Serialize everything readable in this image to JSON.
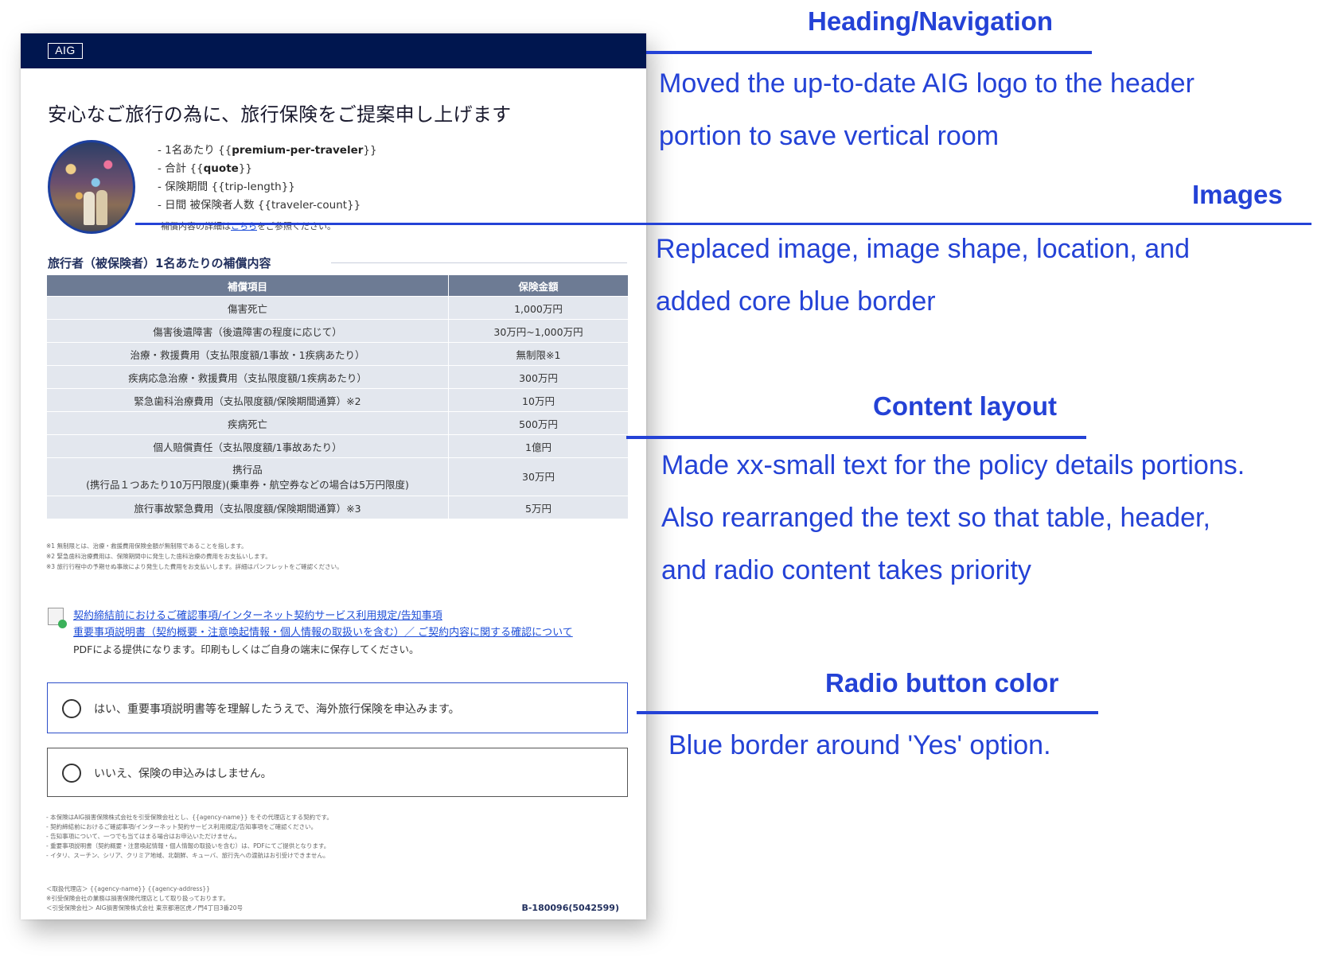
{
  "document": {
    "logo": "AIG",
    "title": "安心なご旅行の為に、旅行保険をご提案申し上げます",
    "premium_lines": [
      {
        "prefix": "- 1名あたり {{",
        "value": "premium-per-traveler",
        "suffix": "}}"
      },
      {
        "prefix": "- 合計 {{",
        "value": "quote",
        "suffix": "}}"
      },
      {
        "prefix": "- 保険期間 {{",
        "value": "trip-length",
        "suffix": "}}"
      },
      {
        "prefix": "- 日間 被保険者人数 {{",
        "value": "traveler-count",
        "suffix": "}}"
      }
    ],
    "detail_prefix": "補償内容の詳細は",
    "detail_link": "こちら",
    "detail_suffix": "をご参照ください。",
    "section_title": "旅行者（被保険者）1名あたりの補償内容",
    "table": {
      "headers": [
        "補償項目",
        "保険金額"
      ],
      "rows": [
        [
          "傷害死亡",
          "1,000万円"
        ],
        [
          "傷害後遺障害（後遺障害の程度に応じて）",
          "30万円~1,000万円"
        ],
        [
          "治療・救援費用（支払限度額/1事故・1疾病あたり）",
          "無制限※1"
        ],
        [
          "疾病応急治療・救援費用（支払限度額/1疾病あたり）",
          "300万円"
        ],
        [
          "緊急歯科治療費用（支払限度額/保険期間通算）※2",
          "10万円"
        ],
        [
          "疾病死亡",
          "500万円"
        ],
        [
          "個人賠償責任（支払限度額/1事故あたり）",
          "1億円"
        ],
        [
          "携行品\n(携行品１つあたり10万円限度)(乗車券・航空券などの場合は5万円限度)",
          "30万円"
        ],
        [
          "旅行事故緊急費用（支払限度額/保険期間通算）※3",
          "5万円"
        ]
      ]
    },
    "notes": [
      "※1 無制限とは、治療・救援費用保険金額が無制限であることを指します。",
      "※2 緊急歯科治療費用は、保険期間中に発生した歯科治療の費用をお支払いします。",
      "※3 旅行行程中の予期せぬ事故により発生した費用をお支払いします。詳細はパンフレットをご確認ください。"
    ],
    "links": [
      "契約締結前におけるご確認事項/インターネット契約サービス利用規定/告知事項",
      "重要事項説明書（契約概要・注意喚起情報・個人情報の取扱いを含む）／ ご契約内容に関する確認について"
    ],
    "links_note": "PDFによる提供になります。印刷もしくはご自身の端末に保存してください。",
    "radio_yes": "はい、重要事項説明書等を理解したうえで、海外旅行保険を申込みます。",
    "radio_no": "いいえ、保険の申込みはしません。",
    "fine_print": [
      "- 本保険はAIG損害保険株式会社を引受保険会社とし、{{agency-name}} をその代理店とする契約です。",
      "- 契約締結前におけるご確認事項/インターネット契約サービス利用規定/告知事項をご確認ください。",
      "- 告知事項について、一つでも当てはまる場合はお申込いただけません。",
      "- 重要事項説明書（契約概要・注意喚起情報・個人情報の取扱いを含む）は、PDFにてご提供となります。",
      "- イタリ、スーチン、シリア、クリミア地域、北朝鮮、キューバ、旅行先への渡航はお引受けできません。"
    ],
    "agency_lines": [
      "＜取扱代理店＞ {{agency-name}}  {{agency-address}}",
      "※引受保険会社の業務は損害保険代理店として取り扱っております。",
      "＜引受保険会社＞ AIG損害保険株式会社 東京都港区虎ノ門4丁目3番20号"
    ],
    "doc_number": "B-180096(5042599)"
  },
  "annotations": [
    {
      "heading": "Heading/Navigation",
      "lines": [
        "Moved the up-to-date AIG logo to the header",
        "portion to save vertical room"
      ]
    },
    {
      "heading": "Images",
      "lines": [
        "Replaced image, image shape, location, and",
        "added core blue border"
      ]
    },
    {
      "heading": "Content layout",
      "lines": [
        "Made xx-small text for the policy details portions.",
        "Also rearranged the text so that table, header,",
        "and radio content takes priority"
      ]
    },
    {
      "heading": "Radio button color",
      "lines": [
        "Blue border around 'Yes' option."
      ]
    }
  ],
  "colors": {
    "header_navy": "#00164f",
    "annotation_blue": "#2442d6",
    "table_header": "#6d7b94",
    "table_cell": "#e3e7ee",
    "yes_border": "#2c4ec9"
  }
}
